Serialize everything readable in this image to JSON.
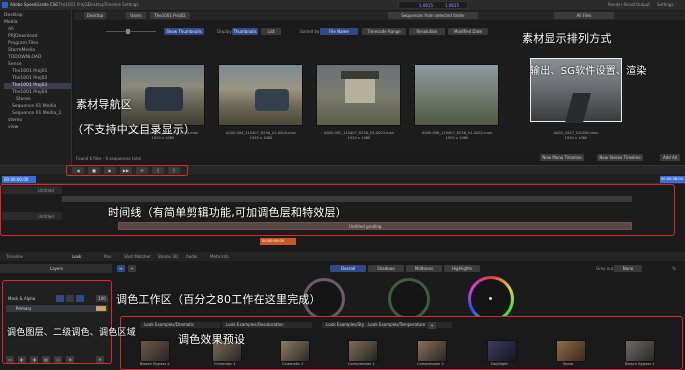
{
  "window": {
    "title": "Adobe SpeedGrade CS6",
    "tabs": [
      "The1001 Proj02",
      "Desktop",
      "Timeline",
      "Settings"
    ],
    "top_right_buttons": [
      "Render Result",
      "Output",
      "Settings"
    ],
    "timecode_readout": "1.0615",
    "timecode_readout2": "1.0615"
  },
  "browser": {
    "nav": [
      "Desktop",
      "Users",
      "The1001 Proj02"
    ],
    "path_dropdown": "Sequences from selected folder",
    "filter_dropdown": "All Files",
    "tree": [
      "Desktop",
      "Media",
      "All",
      "PRJDownload",
      "Program Files",
      "StormMedia",
      "TODOWNLOAD",
      "Sense",
      "The1001 Proj01",
      "The1001 Proj02",
      "The1001 Proj03",
      "The1001 Proj04",
      "Stereo",
      "Sequence 01 Media",
      "Sequence 01 Media_1",
      "stereo",
      "view"
    ],
    "toolbar": {
      "show_thumbnails": "Show Thumbnails",
      "display_label": "Display",
      "display_value": "Thumbnails",
      "list": "List",
      "sorted_by": "Sorted by",
      "file_name": "File Name",
      "timecode_range": "Timecode Range",
      "resolution": "Resolution",
      "modified_date": "Modified Date"
    },
    "thumbs": [
      {
        "name": "A000.000_110407_R236_V1-0005.mov",
        "res": "1920 x 1080"
      },
      {
        "name": "A000.004_110407_R236_V1-0004.mov",
        "res": "1920 x 1080"
      },
      {
        "name": "A000.002_110407_R236_V1-0003.mov",
        "res": "1920 x 1080"
      },
      {
        "name": "A000.006_110407_R236_V1-0002.mov",
        "res": "1920 x 1080"
      },
      {
        "name": "A002_C027_010000.mov",
        "res": "1920 x 1080"
      }
    ],
    "found_text": "Found 6 files - 6 sequences total",
    "buttons": [
      "New Mono Timeline",
      "New Stereo Timeline",
      "Add All"
    ]
  },
  "timeline": {
    "timecode": "00:00:00:00",
    "end_timecode": "00:00:58:00",
    "track1_label": "Untitled",
    "track2_label": "Untitled",
    "clip_label": "Untitled grading",
    "marker_label": "00:00:00:00"
  },
  "grading": {
    "panel_tabs": [
      "Timeline",
      "Look",
      "Pan",
      "Shot Matcher",
      "Stereo 3D",
      "Audio",
      "Meta Info"
    ],
    "layers_label": "Layers",
    "mask_label": "Mask & Alpha",
    "primary_label": "Primary",
    "layer_percent": "100",
    "zone_tabs": [
      "Overall",
      "Shadows",
      "Midtones",
      "Highlights"
    ],
    "grey_out": "Grey out",
    "grey_out_value": "None"
  },
  "presets": {
    "tabs": [
      ".Look Examples/Dramatic",
      ".Look Examples/Desaturation",
      ".Look Examples/Style",
      ".Look Examples/Temperature"
    ],
    "items": [
      "Bleach Bypass 2",
      "Cinematic 1",
      "Cinematic 2",
      "Compression 1",
      "Compression 2",
      "DayNight",
      "Sepia",
      "Bleach Bypass 1"
    ]
  },
  "annotations": {
    "sort_modes": "素材显示排列方式",
    "output_settings": "输出、SG软件设置、渲染",
    "nav_area": "素材导航区",
    "no_chinese": "（不支持中文目录显示）",
    "timeline_desc": "时间线（有简单剪辑功能,可加调色层和特效层）",
    "grading_area": "调色工作区（百分之80工作在这里完成）",
    "presets_desc": "调色效果预设",
    "layers_desc": "调色图层、二级调色、调色区域"
  },
  "colors": {
    "accent_blue": "#2f4a86",
    "highlight_red": "#e0262a",
    "timecode_blue": "#3b6fd8"
  }
}
